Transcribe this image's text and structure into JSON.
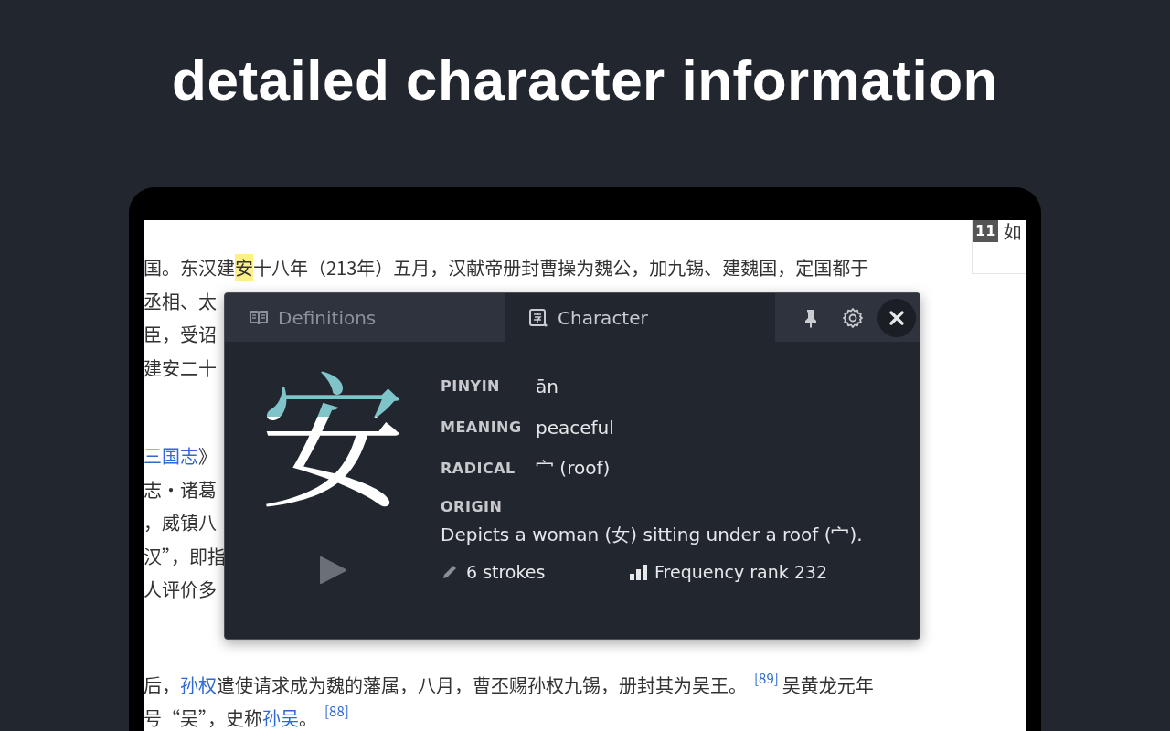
{
  "headline": "detailed character information",
  "article": {
    "paragraphs": [
      [
        [
          {
            "kind": "text",
            "text": "国。东汉建"
          },
          {
            "kind": "highlight",
            "text": "安"
          },
          {
            "kind": "text",
            "text": "十八年（213年）五月，汉献帝册封曹操为魏公，加九锡、建魏国，定国都于"
          }
        ],
        [
          {
            "kind": "text",
            "text": "丞相、太"
          }
        ],
        [
          {
            "kind": "text",
            "text": "臣，受诏"
          }
        ],
        [
          {
            "kind": "text",
            "text": "建安二十"
          }
        ]
      ],
      [
        [
          {
            "kind": "link",
            "text": "三国志"
          },
          {
            "kind": "text",
            "text": "》"
          }
        ],
        [
          {
            "kind": "text",
            "text": "志·诸葛"
          }
        ],
        [
          {
            "kind": "text",
            "text": "，威镇八"
          }
        ],
        [
          {
            "kind": "text",
            "text": "汉”，即指"
          }
        ],
        [
          {
            "kind": "text",
            "text": "人评价多"
          }
        ]
      ],
      [
        [
          {
            "kind": "text",
            "text": "后，"
          },
          {
            "kind": "link",
            "text": "孙权"
          },
          {
            "kind": "text",
            "text": "遣使请求成为魏的藩属，八月，曹丕赐孙权九锡，册封其为吴王。"
          },
          {
            "kind": "ref",
            "text": "[89]"
          },
          {
            "kind": "text",
            "text": "吴黄龙元年"
          }
        ],
        [
          {
            "kind": "text",
            "text": "号“吴”，史称"
          },
          {
            "kind": "link",
            "text": "孙吴"
          },
          {
            "kind": "text",
            "text": "。"
          },
          {
            "kind": "ref",
            "text": "[88]"
          }
        ]
      ]
    ]
  },
  "sidebar": {
    "badge": "11",
    "text": "如"
  },
  "popup": {
    "tabs": [
      {
        "label": "Definitions",
        "selected": false,
        "kind": "book"
      },
      {
        "label": "Character",
        "selected": true,
        "kind": "card"
      }
    ],
    "actions": [
      {
        "kind": "pin"
      },
      {
        "kind": "settings"
      },
      {
        "kind": "close"
      }
    ],
    "character": "安",
    "fields": [
      {
        "label": "PINYIN",
        "value": "ān"
      },
      {
        "label": "MEANING",
        "value": "peaceful"
      },
      {
        "label": "RADICAL",
        "value": "宀 (roof)"
      }
    ],
    "origin": {
      "label": "ORIGIN",
      "text": "Depicts a woman (女) sitting under a roof (宀)."
    },
    "stats": [
      {
        "kind": "strokes",
        "text": "6 strokes"
      },
      {
        "kind": "frequency",
        "text": "Frequency rank 232"
      }
    ]
  }
}
